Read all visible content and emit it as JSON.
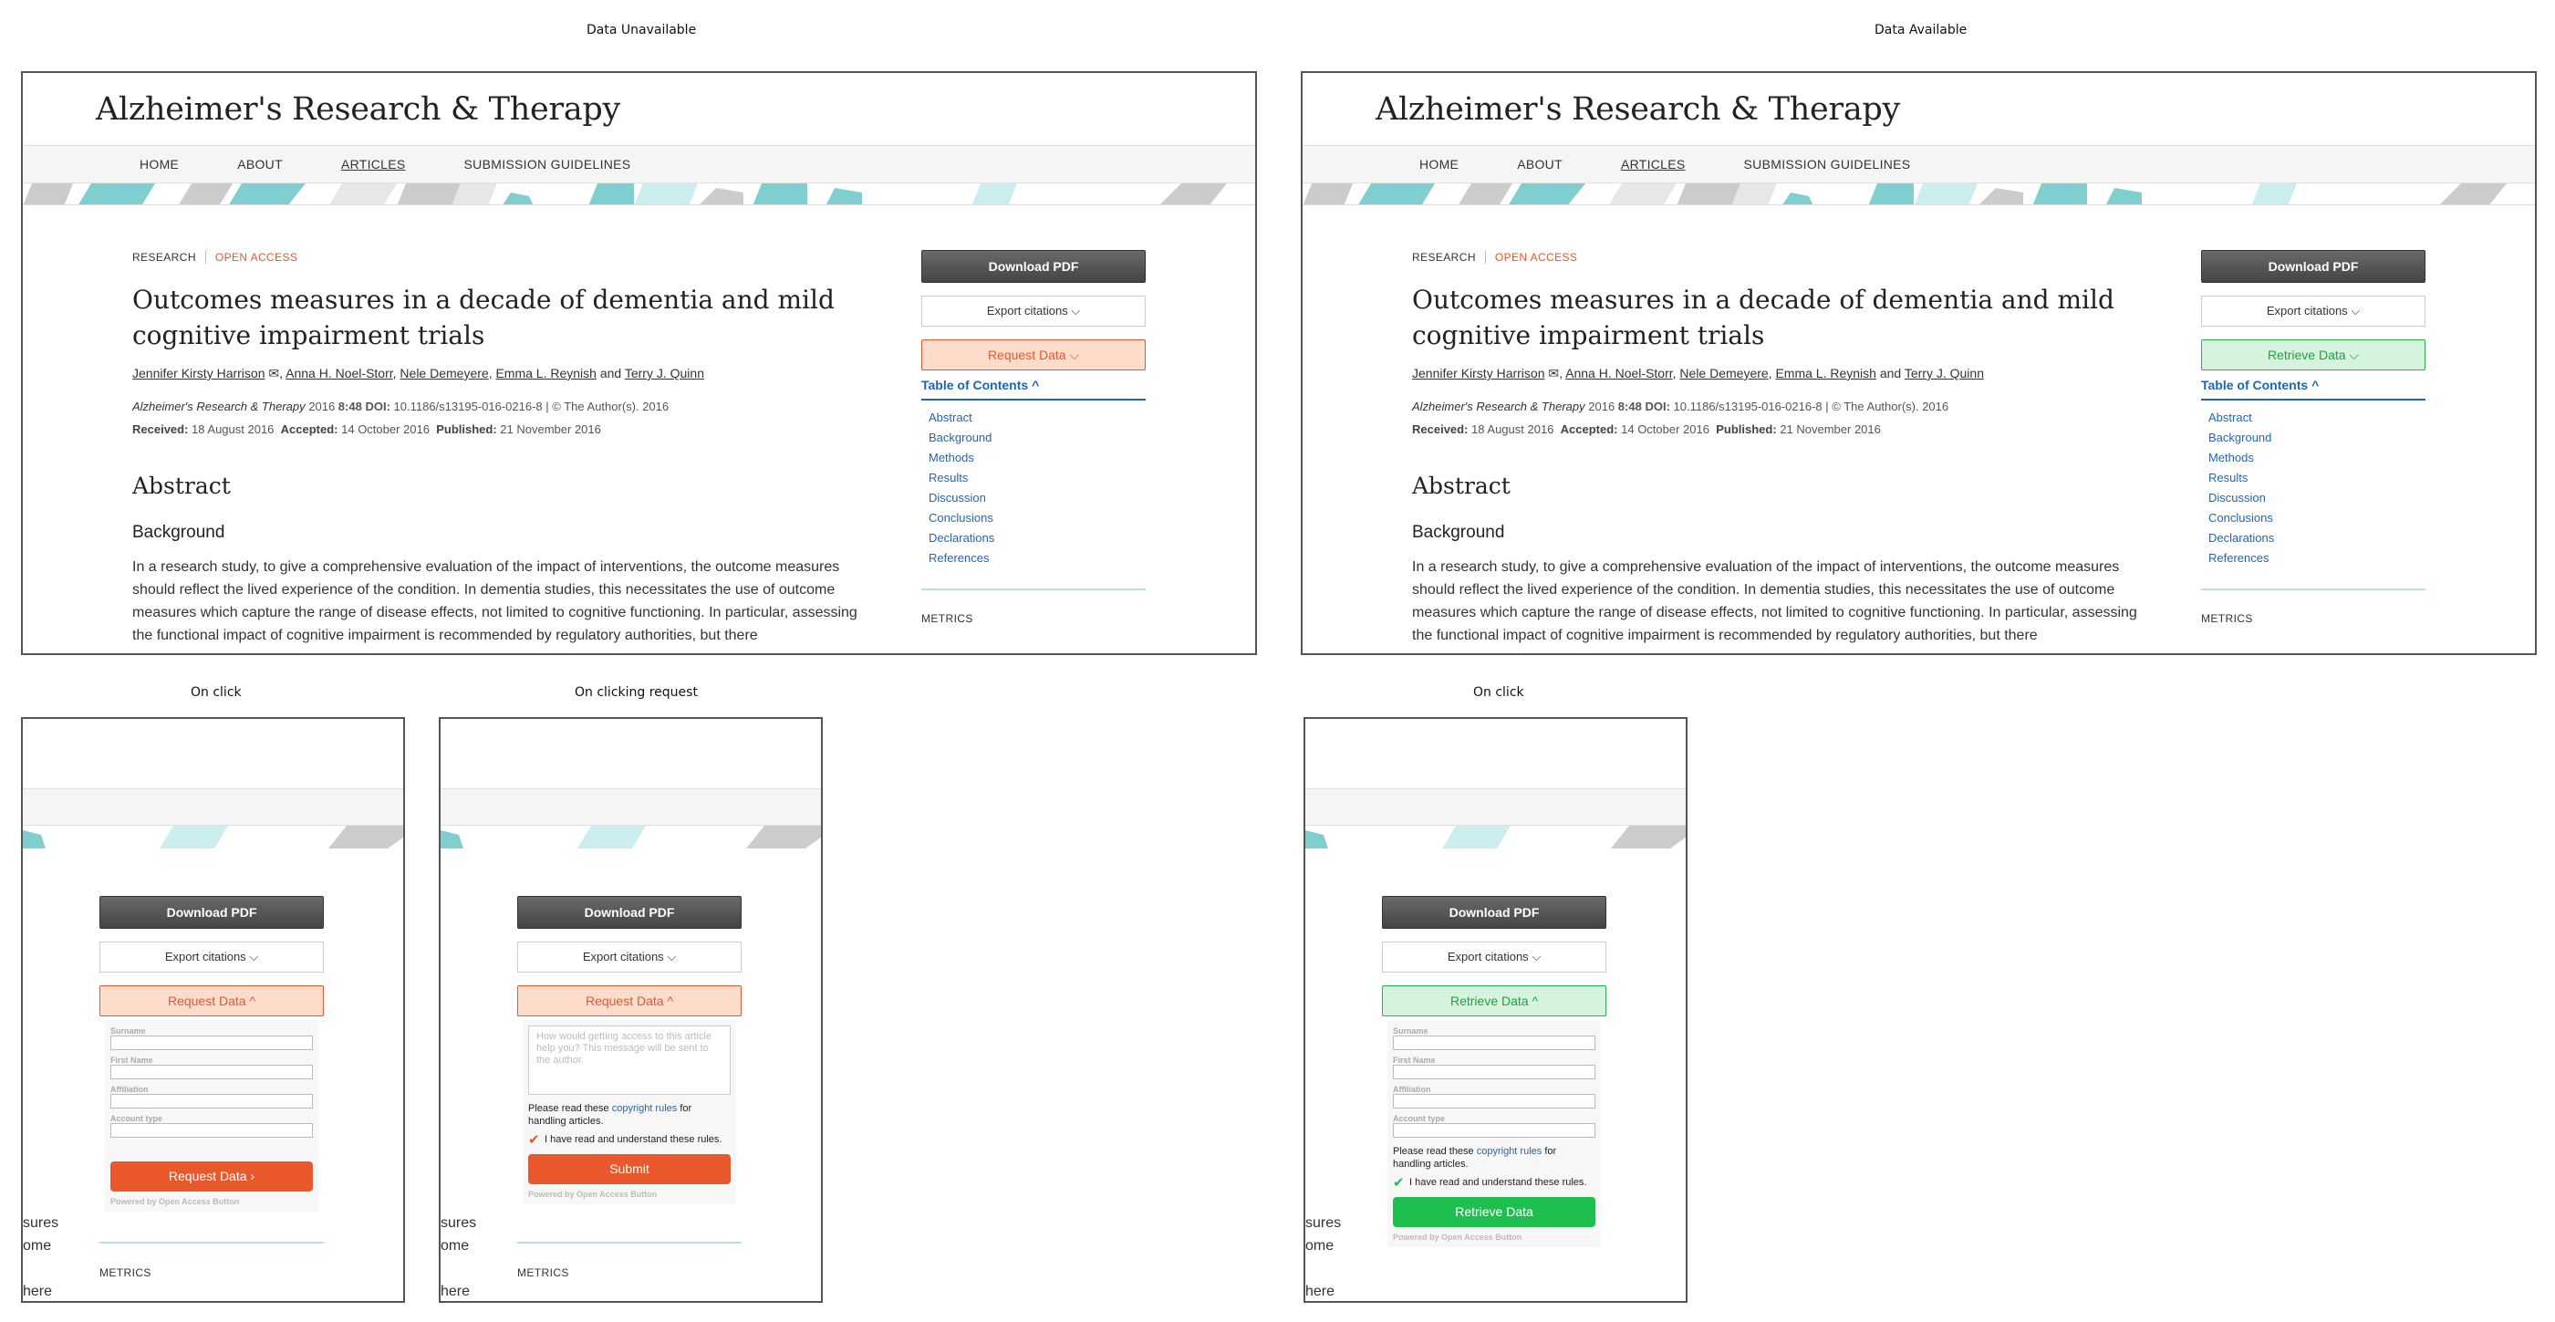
{
  "labels": {
    "data_unavailable": "Data Unavailable",
    "data_available": "Data Available",
    "on_click_a": "On click",
    "on_clicking_request": "On clicking request",
    "on_click_b": "On click"
  },
  "journal": {
    "title": "Alzheimer's Research & Therapy"
  },
  "nav": {
    "items": [
      "HOME",
      "ABOUT",
      "ARTICLES",
      "SUBMISSION GUIDELINES"
    ],
    "active": "ARTICLES"
  },
  "article": {
    "type": "RESEARCH",
    "access": "OPEN ACCESS",
    "title": "Outcomes measures in a decade of dementia and mild cognitive impairment trials",
    "authors": [
      "Jennifer Kirsty Harrison",
      "Anna H. Noel-Storr",
      "Nele Demeyere",
      "Emma L. Reynish",
      "Terry J. Quinn"
    ],
    "author_sep": ", ",
    "author_and": " and ",
    "journal_italic": "Alzheimer's Research & Therapy",
    "year": "2016",
    "volume": "8:48",
    "doi_label": "DOI:",
    "doi": "10.1186/s13195-016-0216-8",
    "copyright": "© The Author(s). 2016",
    "received_label": "Received:",
    "received": "18 August 2016",
    "accepted_label": "Accepted:",
    "accepted": "14 October 2016",
    "published_label": "Published:",
    "published": "21 November 2016",
    "abstract_heading": "Abstract",
    "background_heading": "Background",
    "abstract_text": "In a research study, to give a comprehensive evaluation of the impact of interventions, the outcome measures should reflect the lived experience of the condition. In dementia studies, this necessitates the use of outcome measures which capture the range of disease effects, not limited to cognitive functioning. In particular, assessing the functional impact of cognitive impairment is recommended by regulatory authorities, but there"
  },
  "sidebar": {
    "download_pdf": "Download PDF",
    "export_citations": "Export citations",
    "request_data": "Request Data",
    "retrieve_data": "Retrieve Data",
    "toc_heading": "Table of Contents",
    "toc_items": [
      "Abstract",
      "Background",
      "Methods",
      "Results",
      "Discussion",
      "Conclusions",
      "Declarations",
      "References"
    ],
    "metrics": "METRICS"
  },
  "form": {
    "surname": "Surname",
    "first_name": "First Name",
    "affiliation": "Affiliation",
    "account_type": "Account type",
    "request_button": "Request Data",
    "submit_button": "Submit",
    "retrieve_button": "Retrieve Data",
    "powered": "Powered by Open Access Button",
    "message_placeholder": "How would getting access to this article help you? This message will be sent to the author.",
    "rules_prefix": "Please read these ",
    "rules_link": "copyright rules",
    "rules_suffix": " for handling articles.",
    "agree": "I have read and understand these rules."
  },
  "fragments": {
    "line1": "sures",
    "line2": "ome",
    "line3": "here"
  },
  "colors": {
    "request_orange": "#e8582a",
    "retrieve_green": "#1fbf4f",
    "toc_blue": "#1d66b5",
    "teal": "#7fcfd0"
  }
}
